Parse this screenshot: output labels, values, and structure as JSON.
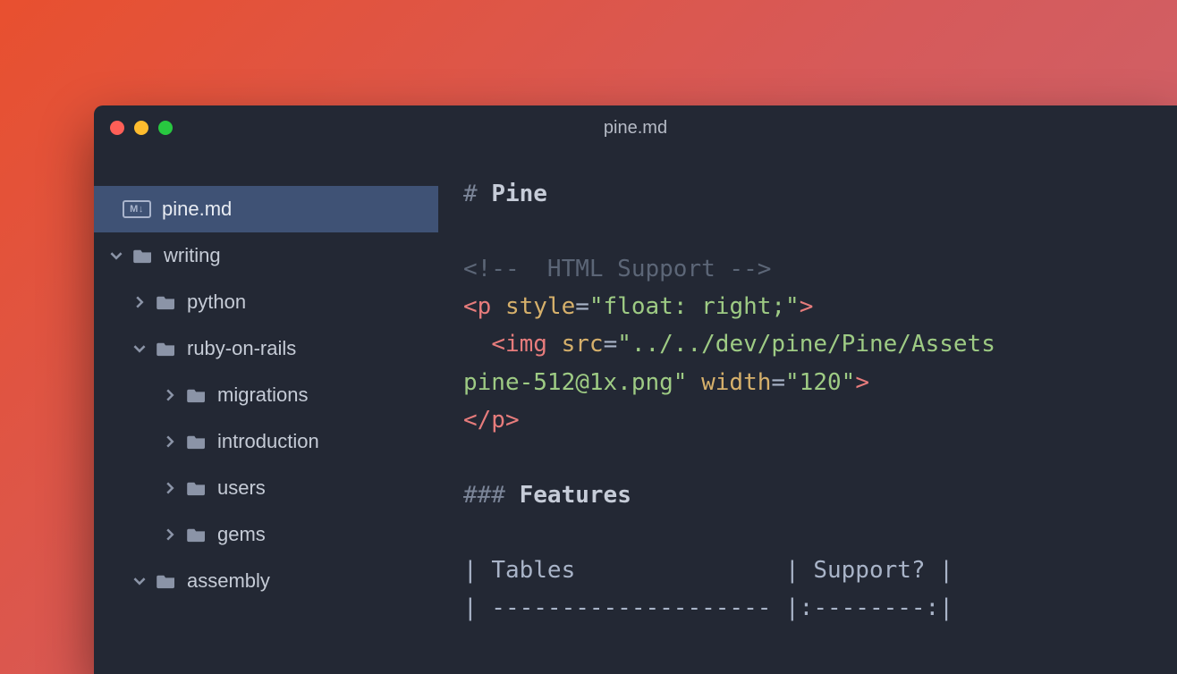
{
  "window": {
    "title": "pine.md"
  },
  "sidebar": {
    "selected_file": "pine.md",
    "tree": [
      {
        "label": "writing",
        "expanded": true,
        "depth": 1
      },
      {
        "label": "python",
        "expanded": false,
        "depth": 2
      },
      {
        "label": "ruby-on-rails",
        "expanded": true,
        "depth": 2
      },
      {
        "label": "migrations",
        "expanded": false,
        "depth": 3
      },
      {
        "label": "introduction",
        "expanded": false,
        "depth": 3
      },
      {
        "label": "users",
        "expanded": false,
        "depth": 3
      },
      {
        "label": "gems",
        "expanded": false,
        "depth": 3
      },
      {
        "label": "assembly",
        "expanded": true,
        "depth": 2
      }
    ]
  },
  "editor": {
    "lines": {
      "l1_hash": "# ",
      "l1_text": "Pine",
      "l3_comment": "<!--  HTML Support -->",
      "l4_tag_open": "<p ",
      "l4_attr": "style",
      "l4_eq": "=",
      "l4_str": "\"float: right;\"",
      "l4_close": ">",
      "l5_indent": "  ",
      "l5_tag": "<img ",
      "l5_attr1": "src",
      "l5_str1": "\"../../dev/pine/Pine/Assets",
      "l6_text": "pine-512@1x.png\"",
      "l6_attr": " width",
      "l6_str": "\"120\"",
      "l6_close": ">",
      "l7_tag": "</p>",
      "l9_hash": "### ",
      "l9_text": "Features",
      "l11_pipe1": "| ",
      "l11_h1": "Tables",
      "l11_mid": "               | ",
      "l11_h2": "Support?",
      "l11_end": " |",
      "l12_row": "| -------------------- |:--------:|"
    }
  },
  "icons": {
    "markdown_badge": "M↓"
  }
}
